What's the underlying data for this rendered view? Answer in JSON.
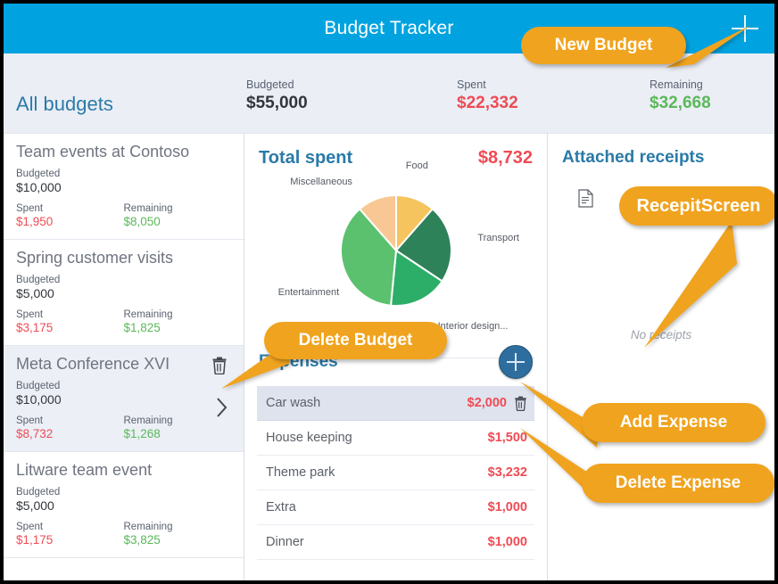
{
  "header": {
    "title": "Budget Tracker",
    "new_budget_icon": "plus-icon"
  },
  "summary": {
    "title": "All budgets",
    "budgeted_label": "Budgeted",
    "budgeted_value": "$55,000",
    "spent_label": "Spent",
    "spent_value": "$22,332",
    "remaining_label": "Remaining",
    "remaining_value": "$32,668"
  },
  "budget_list": {
    "labels": {
      "budgeted": "Budgeted",
      "spent": "Spent",
      "remaining": "Remaining"
    },
    "items": [
      {
        "name": "Team events at Contoso",
        "budgeted": "$10,000",
        "spent": "$1,950",
        "remaining": "$8,050",
        "selected": false
      },
      {
        "name": "Spring customer visits",
        "budgeted": "$5,000",
        "spent": "$3,175",
        "remaining": "$1,825",
        "selected": false
      },
      {
        "name": "Meta Conference XVI",
        "budgeted": "$10,000",
        "spent": "$8,732",
        "remaining": "$1,268",
        "selected": true
      },
      {
        "name": "Litware team event",
        "budgeted": "$5,000",
        "spent": "$1,175",
        "remaining": "$3,825",
        "selected": false
      }
    ]
  },
  "total_spent": {
    "title": "Total spent",
    "value": "$8,732"
  },
  "chart_data": {
    "type": "pie",
    "title": "Total spent",
    "total": 8732,
    "labels": [
      "Food",
      "Transport",
      "Interior design...",
      "Entertainment",
      "Miscellaneous"
    ],
    "values": [
      1000,
      2000,
      1500,
      3232,
      1000
    ],
    "percentages": [
      11.5,
      22.9,
      17.2,
      37.0,
      11.5
    ],
    "colors": [
      "#f5c45e",
      "#2d8259",
      "#2cae68",
      "#5bc16e",
      "#f8c793"
    ],
    "legend": "labels-outside",
    "grid": false
  },
  "expenses": {
    "title": "Expenses",
    "add_icon": "plus-icon",
    "rows": [
      {
        "name": "Car wash",
        "amount": "$2,000",
        "selected": true,
        "delete_icon": "trash-icon"
      },
      {
        "name": "House keeping",
        "amount": "$1,500",
        "selected": false
      },
      {
        "name": "Theme park",
        "amount": "$3,232",
        "selected": false
      },
      {
        "name": "Extra",
        "amount": "$1,000",
        "selected": false
      },
      {
        "name": "Dinner",
        "amount": "$1,000",
        "selected": false
      }
    ]
  },
  "receipts": {
    "title": "Attached receipts",
    "doc_icon": "document-icon",
    "empty_text": "No receipts"
  },
  "annotations": [
    {
      "id": "new-budget",
      "label": "New Budget"
    },
    {
      "id": "receipt-screen",
      "label": "RecepitScreen"
    },
    {
      "id": "delete-budget",
      "label": "Delete Budget"
    },
    {
      "id": "add-expense",
      "label": "Add Expense"
    },
    {
      "id": "delete-expense",
      "label": "Delete Expense"
    }
  ],
  "colors": {
    "header_blue": "#00a3e0",
    "accent_blue": "#2a7aa8",
    "spent_red": "#ef4b54",
    "remaining_green": "#5bb85b",
    "callout_orange": "#f0a31e",
    "summary_bg": "#ebeef5"
  }
}
